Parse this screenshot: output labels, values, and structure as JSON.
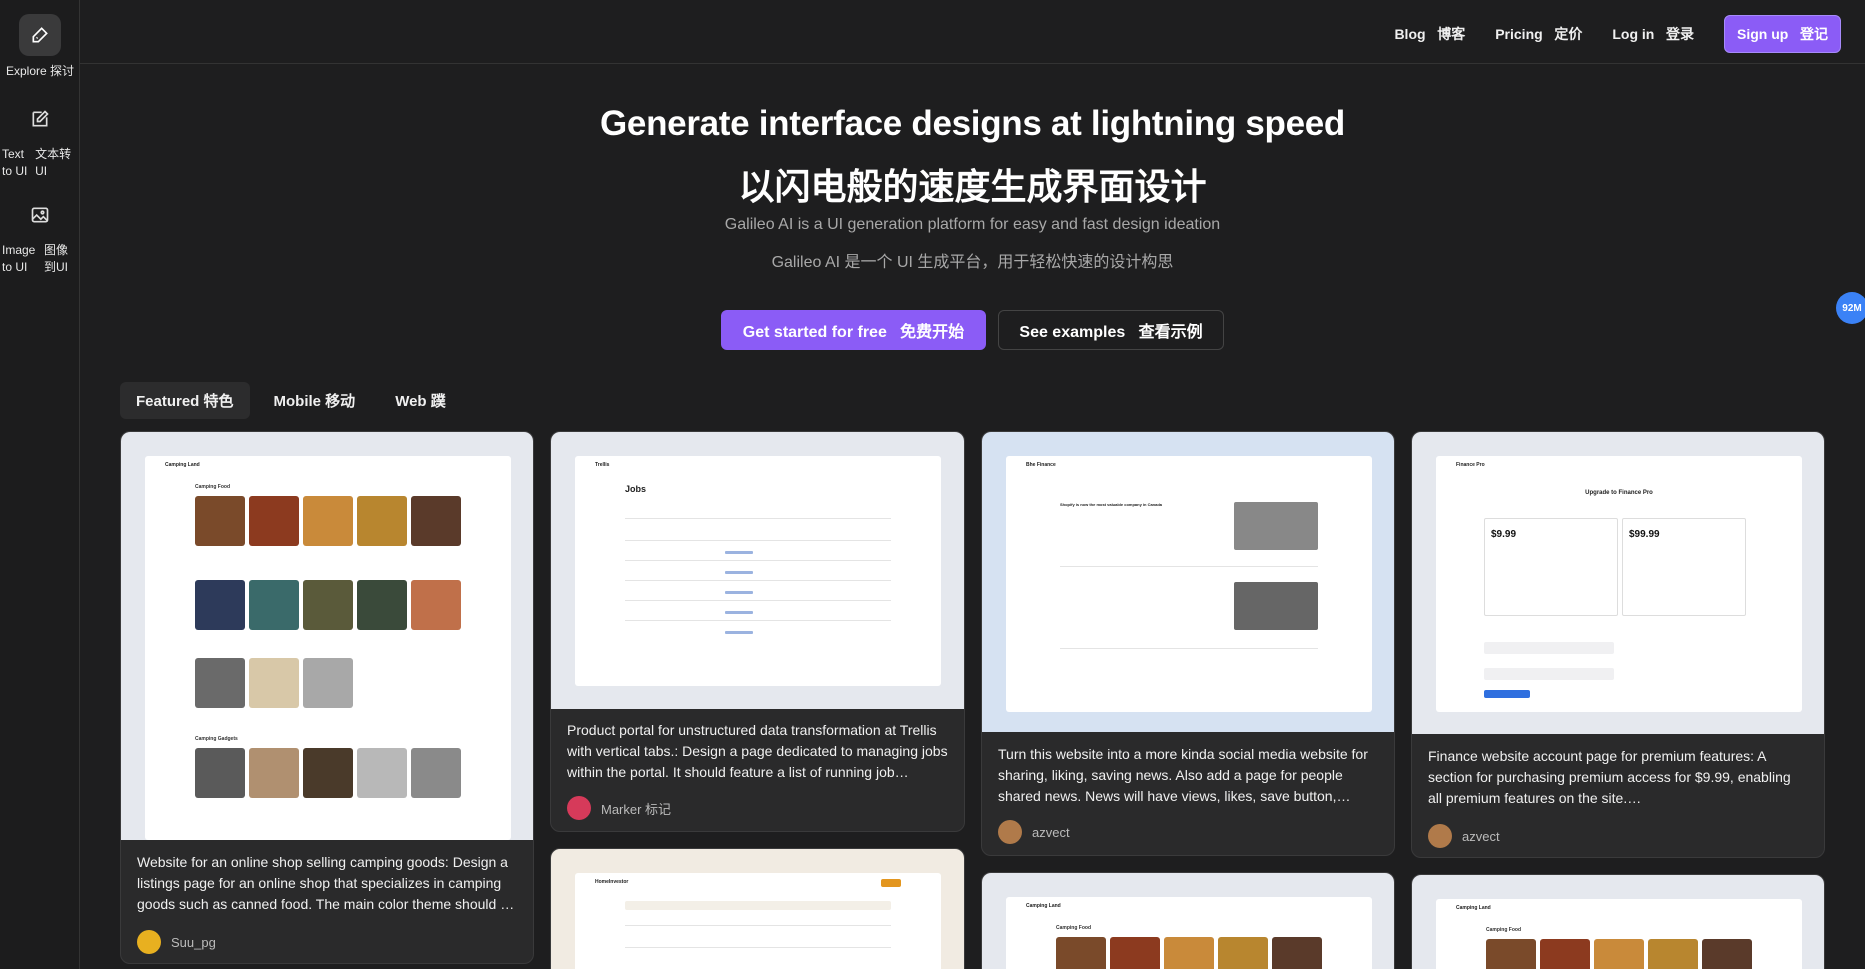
{
  "sidebar": {
    "items": [
      {
        "label_en": "Explore",
        "label_cn": "探讨",
        "icon": "compass-icon"
      },
      {
        "label_en": "Text to UI",
        "label_cn": "文本转 UI",
        "icon": "edit-icon"
      },
      {
        "label_en": "Image to UI",
        "label_cn": "图像 到UI",
        "icon": "image-icon"
      }
    ]
  },
  "nav": {
    "blog": "Blog   博客",
    "pricing": "Pricing   定价",
    "login": "Log in   登录",
    "signup": "Sign up   登记"
  },
  "hero": {
    "title": "Generate interface designs at lightning speed",
    "title_cn": "以闪电般的速度生成界面设计",
    "subtitle": "Galileo AI is a UI generation platform for easy and fast design ideation",
    "subtitle_cn": "Galileo AI 是一个 UI 生成平台，用于轻松快速的设计构思",
    "cta_primary": "Get started for free   免费开始",
    "cta_secondary": "See examples   查看示例"
  },
  "float_badge": "92M",
  "tabs": [
    "Featured 特色",
    "Mobile 移动",
    "Web 蹼"
  ],
  "cards": [
    {
      "desc": "Website for an online shop selling camping goods: Design a listings page for an online shop that specializes in camping goods such as canned food. The main color theme should …",
      "author": "Suu_pg",
      "preview_title": "Camping Land",
      "section": "Camping Food",
      "section2": "Camping Gadgets"
    },
    {
      "desc": "Product portal for unstructured data transformation at Trellis with vertical tabs.: Design a page dedicated to managing jobs within the portal. It should feature a list of running job…",
      "author": "Marker 标记",
      "preview_title": "Trellis",
      "section": "Jobs"
    },
    {
      "desc": "Turn this website into a more kinda social media website for sharing, liking, saving news. Also add a page for people shared news. News will have views, likes, save button,…",
      "author": "azvect",
      "preview_title": "Bhe Finance",
      "section": "Shopify is now the most valuable company in Canada"
    },
    {
      "desc": "Finance website account page for premium features: A section for purchasing premium access for $9.99, enabling all premium features on the site.…",
      "author": "azvect",
      "preview_title": "Finance Pro",
      "section": "Upgrade to Finance Pro",
      "price1": "$9.99",
      "price2": "$99.99"
    },
    {
      "preview_title": "HomeInvestor"
    },
    {
      "preview_title": "Camping Land",
      "section": "Camping Food"
    },
    {
      "preview_title": "Camping Land",
      "section": "Camping Food"
    }
  ],
  "colors": {
    "accent": "#8b5cf6",
    "background": "#1e1e1f",
    "card": "#2a2a2b"
  }
}
